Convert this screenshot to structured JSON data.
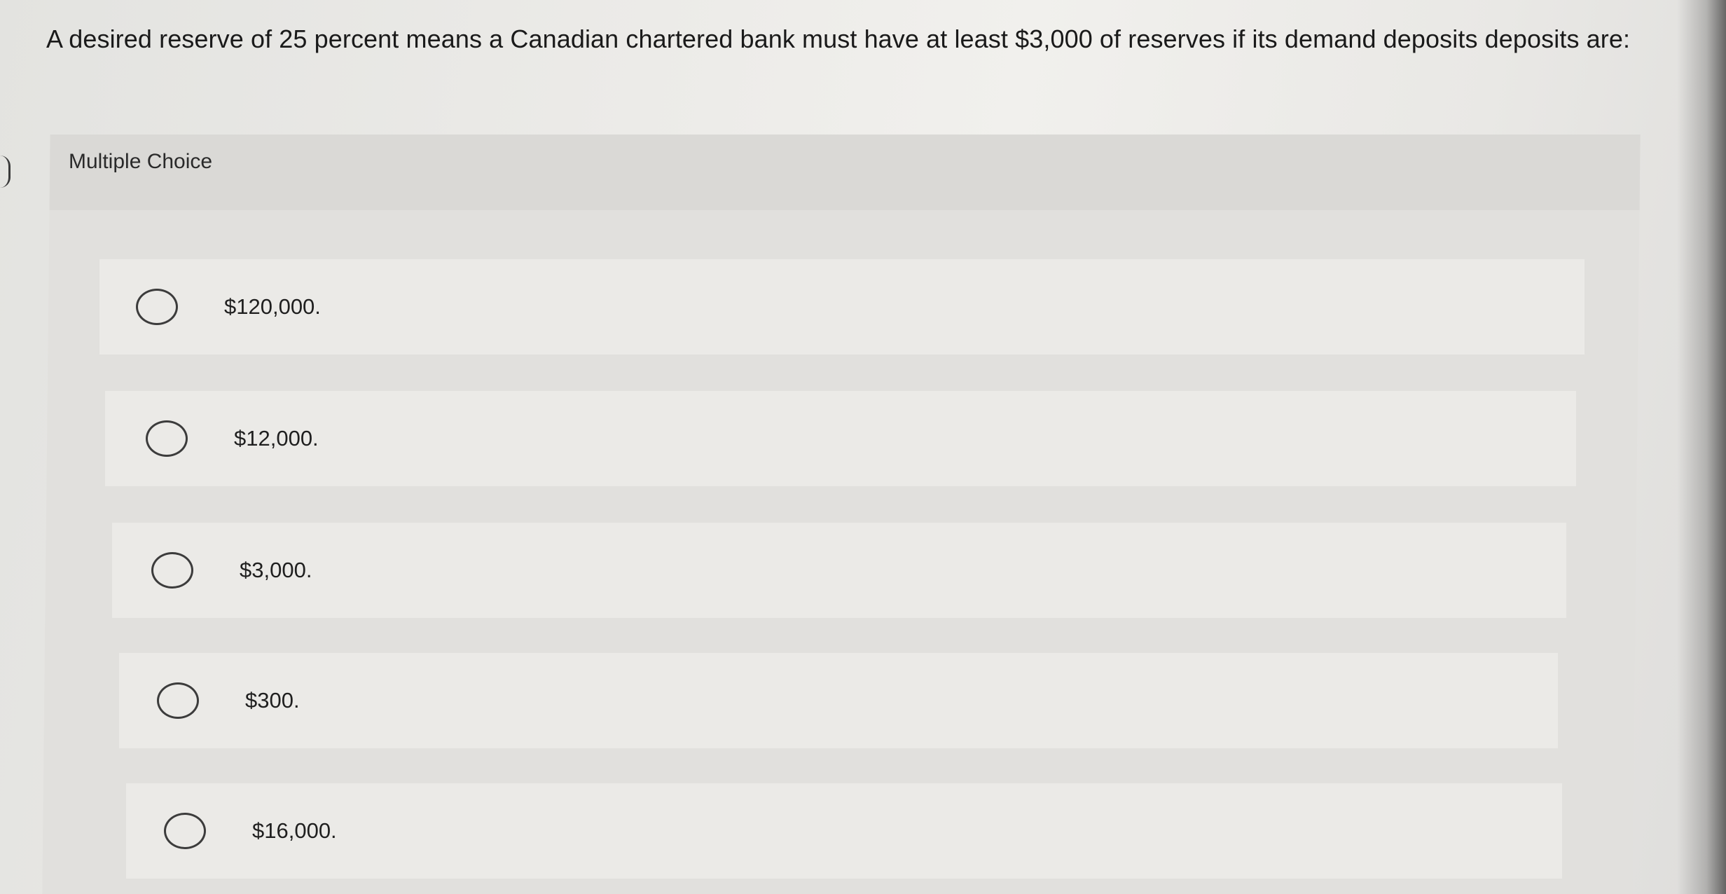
{
  "question": {
    "text": "A desired reserve of 25 percent means a Canadian chartered bank must have at least $3,000 of reserves if its demand deposits deposits are:"
  },
  "panel": {
    "label": "Multiple Choice"
  },
  "choices": [
    {
      "label": "$120,000."
    },
    {
      "label": "$12,000."
    },
    {
      "label": "$3,000."
    },
    {
      "label": "$300."
    },
    {
      "label": "$16,000."
    }
  ]
}
